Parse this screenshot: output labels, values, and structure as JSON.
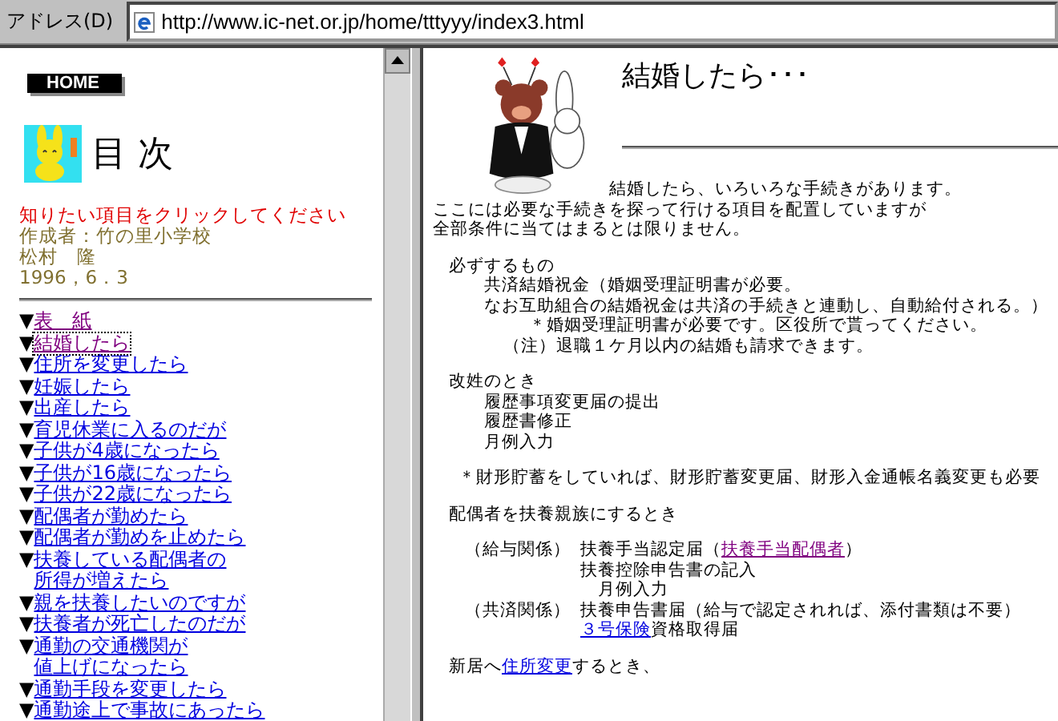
{
  "address_bar": {
    "label": "アドレス(D)",
    "url": "http://www.ic-net.or.jp/home/tttyyy/index3.html"
  },
  "sidebar": {
    "home_button": "HOME",
    "title": "目 次",
    "instruction": "知りたい項目をクリックしてください",
    "author": "作成者：竹の里小学校",
    "name": "松村　隆",
    "date": "1996，6．3",
    "links": [
      {
        "bullet": "▼",
        "lines": [
          "表　紙"
        ],
        "visited": true,
        "focused": false
      },
      {
        "bullet": "▼",
        "lines": [
          "結婚したら"
        ],
        "visited": true,
        "focused": true
      },
      {
        "bullet": "▼",
        "lines": [
          "住所を変更したら"
        ],
        "visited": false,
        "focused": false
      },
      {
        "bullet": "▼",
        "lines": [
          "妊娠したら"
        ],
        "visited": false,
        "focused": false
      },
      {
        "bullet": "▼",
        "lines": [
          "出産したら"
        ],
        "visited": false,
        "focused": false
      },
      {
        "bullet": "▼",
        "lines": [
          "育児休業に入るのだが"
        ],
        "visited": false,
        "focused": false
      },
      {
        "bullet": "▼",
        "lines": [
          "子供が4歳になったら"
        ],
        "visited": false,
        "focused": false
      },
      {
        "bullet": "▼",
        "lines": [
          "子供が16歳になったら"
        ],
        "visited": false,
        "focused": false
      },
      {
        "bullet": "▼",
        "lines": [
          "子供が22歳になったら"
        ],
        "visited": false,
        "focused": false
      },
      {
        "bullet": "▼",
        "lines": [
          "配偶者が勤めたら"
        ],
        "visited": false,
        "focused": false
      },
      {
        "bullet": "▼",
        "lines": [
          "配偶者が勤めを止めたら"
        ],
        "visited": false,
        "focused": false
      },
      {
        "bullet": "▼",
        "lines": [
          "扶養している配偶者の",
          "所得が増えたら"
        ],
        "visited": false,
        "focused": false
      },
      {
        "bullet": "▼",
        "lines": [
          "親を扶養したいのですが"
        ],
        "visited": false,
        "focused": false
      },
      {
        "bullet": "▼",
        "lines": [
          "扶養者が死亡したのだが"
        ],
        "visited": false,
        "focused": false
      },
      {
        "bullet": "▼",
        "lines": [
          "通勤の交通機関が",
          "値上げになったら"
        ],
        "visited": false,
        "focused": false
      },
      {
        "bullet": "▼",
        "lines": [
          "通勤手段を変更したら"
        ],
        "visited": false,
        "focused": false
      },
      {
        "bullet": "▼",
        "lines": [
          "通勤途上で事故にあったら"
        ],
        "visited": false,
        "focused": false
      }
    ]
  },
  "content": {
    "title": "結婚したら･･･",
    "intro": "結婚したら、いろいろな手続きがあります。",
    "sections": [
      {
        "lines": [
          {
            "kind": "plain",
            "parts": [
              {
                "text": "ここには必要な手続きを探って行ける項目を配置していますが"
              }
            ]
          },
          {
            "kind": "plain",
            "parts": [
              {
                "text": "全部条件に当てはまるとは限りません。"
              }
            ]
          }
        ]
      },
      {
        "lines": [
          {
            "kind": "heading",
            "parts": [
              {
                "text": "必ずするもの"
              }
            ]
          },
          {
            "kind": "item",
            "parts": [
              {
                "text": "共済結婚祝金（婚姻受理証明書が必要。"
              }
            ]
          },
          {
            "kind": "item",
            "parts": [
              {
                "text": "なお互助組合の結婚祝金は共済の手続きと連動し、自動給付される。）"
              }
            ]
          },
          {
            "kind": "deep",
            "parts": [
              {
                "text": "＊婚姻受理証明書が必要です。区役所で貰ってください。"
              }
            ]
          },
          {
            "kind": "note",
            "parts": [
              {
                "text": "（注）退職１ケ月以内の結婚も請求できます。"
              }
            ]
          }
        ]
      },
      {
        "lines": [
          {
            "kind": "heading",
            "parts": [
              {
                "text": "改姓のとき"
              }
            ]
          },
          {
            "kind": "item",
            "parts": [
              {
                "text": "履歴事項変更届の提出"
              }
            ]
          },
          {
            "kind": "item",
            "parts": [
              {
                "text": "履歴書修正"
              }
            ]
          },
          {
            "kind": "item",
            "parts": [
              {
                "text": "月例入力"
              }
            ]
          }
        ]
      },
      {
        "lines": [
          {
            "kind": "star",
            "parts": [
              {
                "text": "＊財形貯蓄をしていれば、財形貯蓄変更届、財形入金通帳名義変更も必要"
              }
            ]
          }
        ]
      },
      {
        "lines": [
          {
            "kind": "heading",
            "parts": [
              {
                "text": "配偶者を扶養親族にするとき"
              }
            ]
          }
        ]
      },
      {
        "lines": [
          {
            "kind": "row",
            "label": "（給与関係）",
            "parts": [
              {
                "text": "扶養手当認定届（"
              },
              {
                "kind": "link",
                "text": "扶養手当配偶者",
                "visited": true
              },
              {
                "text": "）"
              }
            ]
          },
          {
            "kind": "row",
            "parts": [
              {
                "text": "扶養控除申告書の記入"
              }
            ]
          },
          {
            "kind": "row",
            "parts": [
              {
                "text": "　月例入力"
              }
            ]
          },
          {
            "kind": "row",
            "label": "（共済関係）",
            "parts": [
              {
                "text": "扶養申告書届（給与で認定されれば、添付書類は不要）"
              }
            ]
          },
          {
            "kind": "row",
            "parts": [
              {
                "kind": "link",
                "text": "３号保険",
                "visited": false
              },
              {
                "text": "資格取得届"
              }
            ]
          }
        ]
      },
      {
        "lines": [
          {
            "kind": "heading",
            "parts": [
              {
                "text": "新居へ"
              },
              {
                "kind": "link",
                "text": "住所変更",
                "visited": false
              },
              {
                "text": "するとき、"
              }
            ]
          }
        ]
      }
    ]
  }
}
